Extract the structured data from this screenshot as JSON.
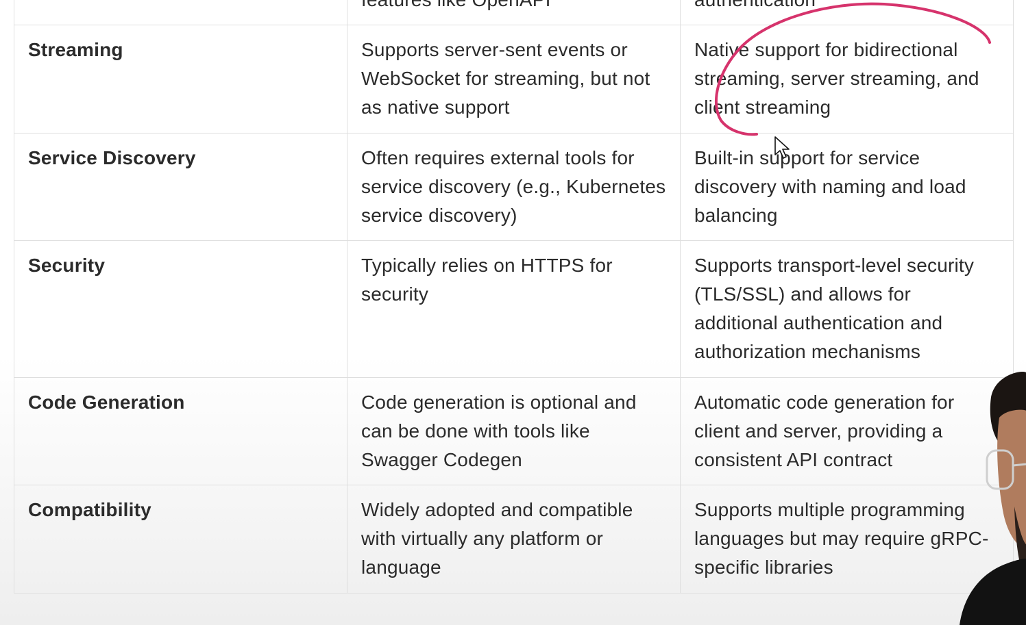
{
  "table": {
    "partial_row": {
      "col2": "features like OpenAPI",
      "col3": "authentication"
    },
    "rows": [
      {
        "feature": "Streaming",
        "rest": "Supports server-sent events or WebSocket for streaming, but not as native support",
        "grpc": "Native support for bidirectional streaming, server streaming, and client streaming"
      },
      {
        "feature": "Service Discovery",
        "rest": "Often requires external tools for service discovery (e.g., Kubernetes service discovery)",
        "grpc": "Built-in support for service discovery with naming and load balancing"
      },
      {
        "feature": "Security",
        "rest": "Typically relies on HTTPS for security",
        "grpc": "Supports transport-level security (TLS/SSL) and allows for additional authentication and authorization mechanisms"
      },
      {
        "feature": "Code Generation",
        "rest": "Code generation is optional and can be done with tools like Swagger Codegen",
        "grpc": "Automatic code generation for client and server, providing a consistent API contract"
      },
      {
        "feature": "Compatibility",
        "rest": "Widely adopted and compatible with virtually any platform or language",
        "grpc": "Supports multiple programming languages but may require gRPC-specific libraries"
      }
    ]
  },
  "overlay": {
    "annotation_color": "#d6336c",
    "annotation_icon": "pen-stroke-icon",
    "cursor_icon": "mouse-pointer-icon",
    "presenter_icon": "presenter-webcam-icon"
  }
}
